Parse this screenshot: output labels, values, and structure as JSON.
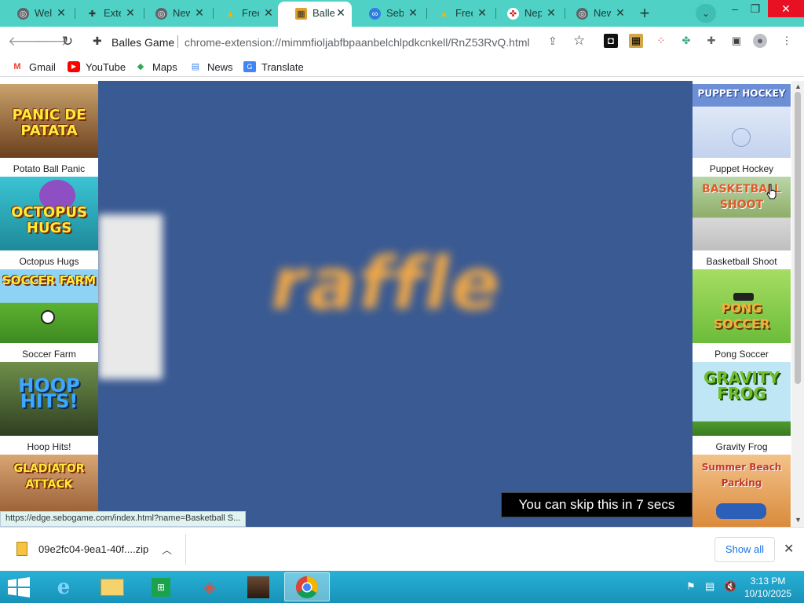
{
  "browser": {
    "tabs": [
      {
        "label": "Welc",
        "icon": "chrome-icon",
        "active": false
      },
      {
        "label": "Exte",
        "icon": "puzzle-icon",
        "active": false
      },
      {
        "label": "New",
        "icon": "chrome-icon",
        "active": false
      },
      {
        "label": "Free",
        "icon": "drive-icon",
        "active": false
      },
      {
        "label": "Balle",
        "icon": "game-icon",
        "active": true
      },
      {
        "label": "Seb",
        "icon": "sebo-icon",
        "active": false
      },
      {
        "label": "Free",
        "icon": "drive-icon",
        "active": false
      },
      {
        "label": "Nep",
        "icon": "nep-icon",
        "active": false
      },
      {
        "label": "New",
        "icon": "chrome-icon",
        "active": false
      }
    ],
    "new_tab": "+",
    "window": {
      "minimize": "–",
      "restore": "❐",
      "close": "✕"
    },
    "toolbar": {
      "site_name": "Balles Game",
      "url": "chrome-extension://mimmfioljabfbpaanbelchlpdkcnkell/RnZ53RvQ.html"
    },
    "bookmarks": [
      {
        "label": "Gmail",
        "icon": "gmail-icon"
      },
      {
        "label": "YouTube",
        "icon": "youtube-icon"
      },
      {
        "label": "Maps",
        "icon": "maps-icon"
      },
      {
        "label": "News",
        "icon": "news-icon"
      },
      {
        "label": "Translate",
        "icon": "translate-icon"
      }
    ]
  },
  "page": {
    "left_games": [
      {
        "label": "Potato Ball Panic",
        "thumb_text": "PANIC DE PATATA",
        "bg": "#8a5a2b"
      },
      {
        "label": "Octopus Hugs",
        "thumb_text": "OCTOPUS HUGS",
        "bg": "#2aa7b8"
      },
      {
        "label": "Soccer Farm",
        "thumb_text": "SOCCER FARM",
        "bg": "#6bbf3a"
      },
      {
        "label": "Hoop Hits!",
        "thumb_text": "HOOP HITS!",
        "bg": "#4c6e2a"
      },
      {
        "label": "",
        "thumb_text": "GLADIATOR ATTACK",
        "bg": "#b86a3a"
      }
    ],
    "right_games": [
      {
        "label": "Puppet Hockey",
        "thumb_text": "PUPPET HOCKEY",
        "bg": "#c6d6ee"
      },
      {
        "label": "Basketball Shoot",
        "thumb_text": "BASKETBALL SHOOT",
        "bg": "#7a9a5a"
      },
      {
        "label": "Pong Soccer",
        "thumb_text": "PONG SOCCER",
        "bg": "#8fd14f"
      },
      {
        "label": "Gravity Frog",
        "thumb_text": "GRAVITY FROG",
        "bg": "#9ad0e8"
      },
      {
        "label": "",
        "thumb_text": "Summer Beach Parking",
        "bg": "#d98a3a"
      }
    ],
    "ad": {
      "logo_text": "raffle",
      "skip_text": "You can skip this in 7 secs"
    },
    "status_url": "https://edge.sebogame.com/index.html?name=Basketball S..."
  },
  "downloads": {
    "file_name": "09e2fc04-9ea1-40f....zip",
    "show_all": "Show all"
  },
  "taskbar": {
    "time": "3:13 PM",
    "date": "10/10/2025"
  },
  "colors": {
    "tabstrip": "#4fd1c5",
    "game_bg": "#3a5a93",
    "ad_logo": "#f0a848"
  }
}
